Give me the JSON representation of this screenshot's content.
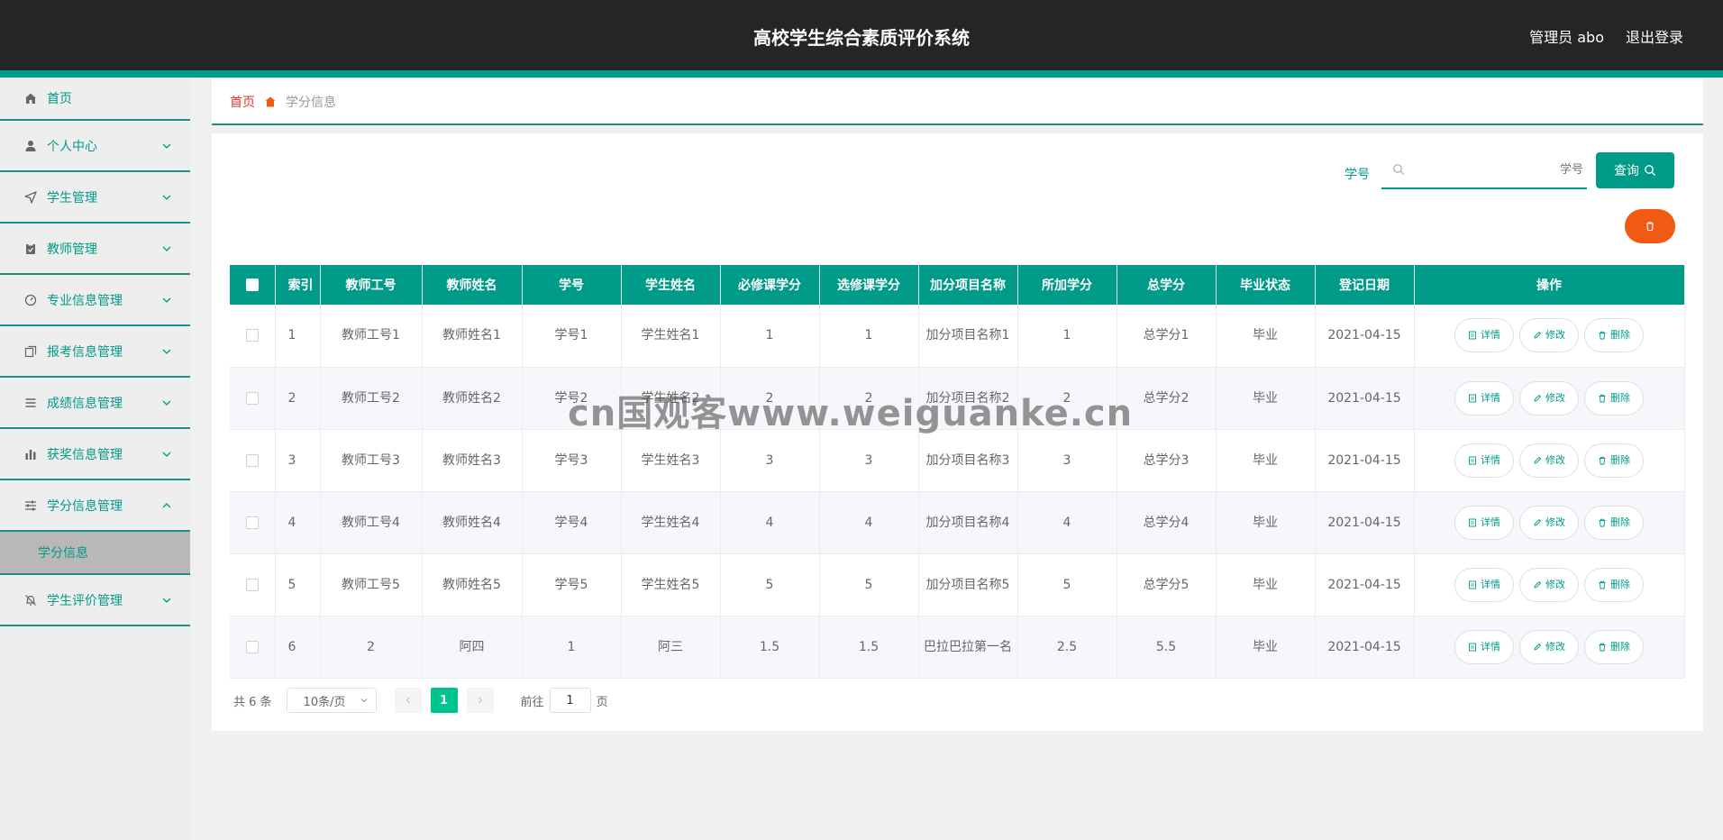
{
  "header": {
    "title": "高校学生综合素质评价系统",
    "user": "管理员 abo",
    "logout": "退出登录"
  },
  "sidebar": {
    "items": [
      {
        "label": "首页",
        "icon": "home-icon"
      },
      {
        "label": "个人中心",
        "icon": "user-icon"
      },
      {
        "label": "学生管理",
        "icon": "navigation-icon"
      },
      {
        "label": "教师管理",
        "icon": "clipboard-icon"
      },
      {
        "label": "专业信息管理",
        "icon": "gauge-icon"
      },
      {
        "label": "报考信息管理",
        "icon": "copy-icon"
      },
      {
        "label": "成绩信息管理",
        "icon": "list-icon"
      },
      {
        "label": "获奖信息管理",
        "icon": "bar-chart-icon"
      },
      {
        "label": "学分信息管理",
        "icon": "sliders-icon"
      },
      {
        "label": "学生评价管理",
        "icon": "bell-off-icon"
      }
    ],
    "submenu": {
      "label": "学分信息"
    }
  },
  "breadcrumb": {
    "home": "首页",
    "current": "学分信息"
  },
  "search": {
    "label": "学号",
    "placeholder": "学号",
    "button": "查询"
  },
  "table": {
    "headers": [
      "索引",
      "教师工号",
      "教师姓名",
      "学号",
      "学生姓名",
      "必修课学分",
      "选修课学分",
      "加分项目名称",
      "所加学分",
      "总学分",
      "毕业状态",
      "登记日期",
      "操作"
    ],
    "rows": [
      [
        "1",
        "教师工号1",
        "教师姓名1",
        "学号1",
        "学生姓名1",
        "1",
        "1",
        "加分项目名称1",
        "1",
        "总学分1",
        "毕业",
        "2021-04-15"
      ],
      [
        "2",
        "教师工号2",
        "教师姓名2",
        "学号2",
        "学生姓名2",
        "2",
        "2",
        "加分项目名称2",
        "2",
        "总学分2",
        "毕业",
        "2021-04-15"
      ],
      [
        "3",
        "教师工号3",
        "教师姓名3",
        "学号3",
        "学生姓名3",
        "3",
        "3",
        "加分项目名称3",
        "3",
        "总学分3",
        "毕业",
        "2021-04-15"
      ],
      [
        "4",
        "教师工号4",
        "教师姓名4",
        "学号4",
        "学生姓名4",
        "4",
        "4",
        "加分项目名称4",
        "4",
        "总学分4",
        "毕业",
        "2021-04-15"
      ],
      [
        "5",
        "教师工号5",
        "教师姓名5",
        "学号5",
        "学生姓名5",
        "5",
        "5",
        "加分项目名称5",
        "5",
        "总学分5",
        "毕业",
        "2021-04-15"
      ],
      [
        "6",
        "2",
        "阿四",
        "1",
        "阿三",
        "1.5",
        "1.5",
        "巴拉巴拉第一名",
        "2.5",
        "5.5",
        "毕业",
        "2021-04-15"
      ]
    ],
    "actions": {
      "detail": "详情",
      "edit": "修改",
      "delete": "删除"
    }
  },
  "pager": {
    "total": "共 6 条",
    "page_size": "10条/页",
    "current_page": "1",
    "goto_label": "前往",
    "goto_value": "1",
    "page_unit": "页"
  },
  "watermark": "cn国观客www.weiguanke.cn",
  "colors": {
    "accent": "#009a88",
    "header_bg": "#252525",
    "danger": "#f25a13",
    "active_page": "#00c38f"
  }
}
